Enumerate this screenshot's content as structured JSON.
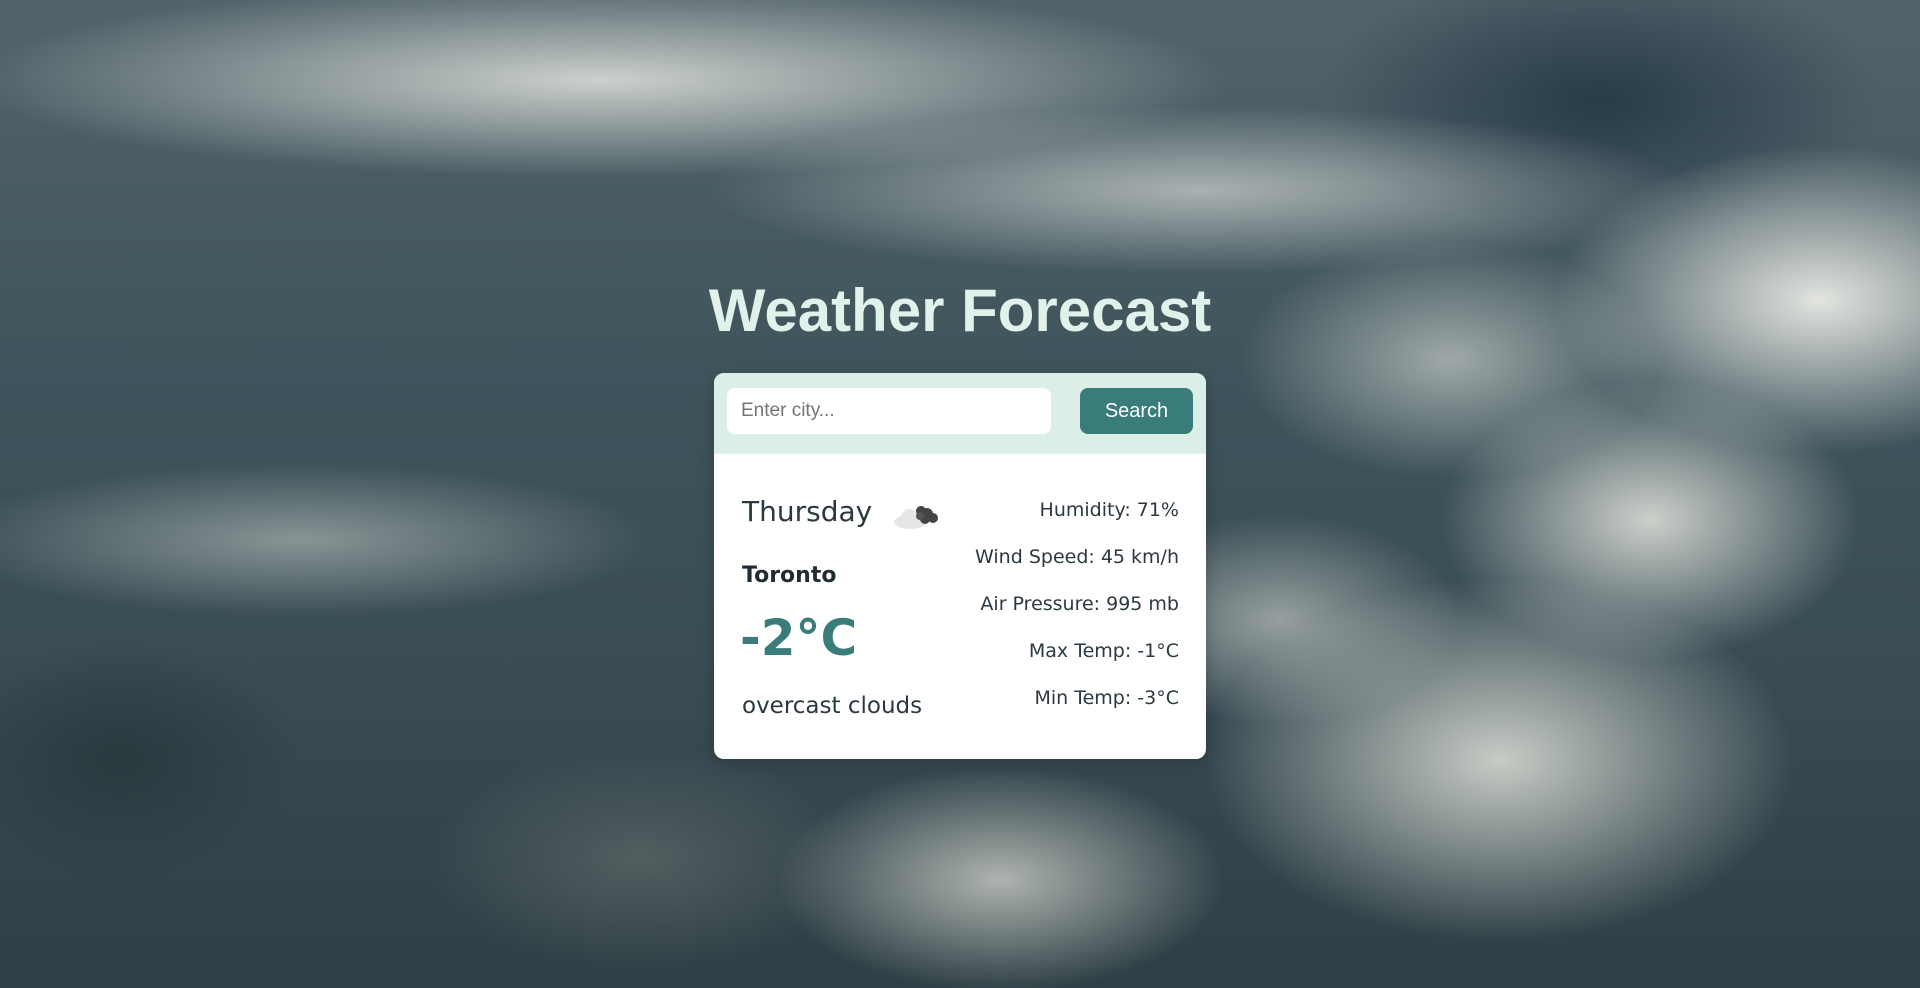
{
  "page": {
    "title": "Weather Forecast"
  },
  "search": {
    "placeholder": "Enter city...",
    "value": "",
    "button_label": "Search"
  },
  "weather": {
    "day": "Thursday",
    "icon": "overcast-clouds-icon",
    "city": "Toronto",
    "temperature": "-2°C",
    "description": "overcast clouds",
    "details": [
      {
        "label": "Humidity: 71%"
      },
      {
        "label": "Wind Speed: 45 km/h"
      },
      {
        "label": "Air Pressure: 995 mb"
      },
      {
        "label": "Max Temp: -1°C"
      },
      {
        "label": "Min Temp: -3°C"
      }
    ]
  },
  "colors": {
    "accent": "#3a7c7a",
    "title": "#e0f2ea",
    "search_bar_bg": "#dcefe6"
  }
}
